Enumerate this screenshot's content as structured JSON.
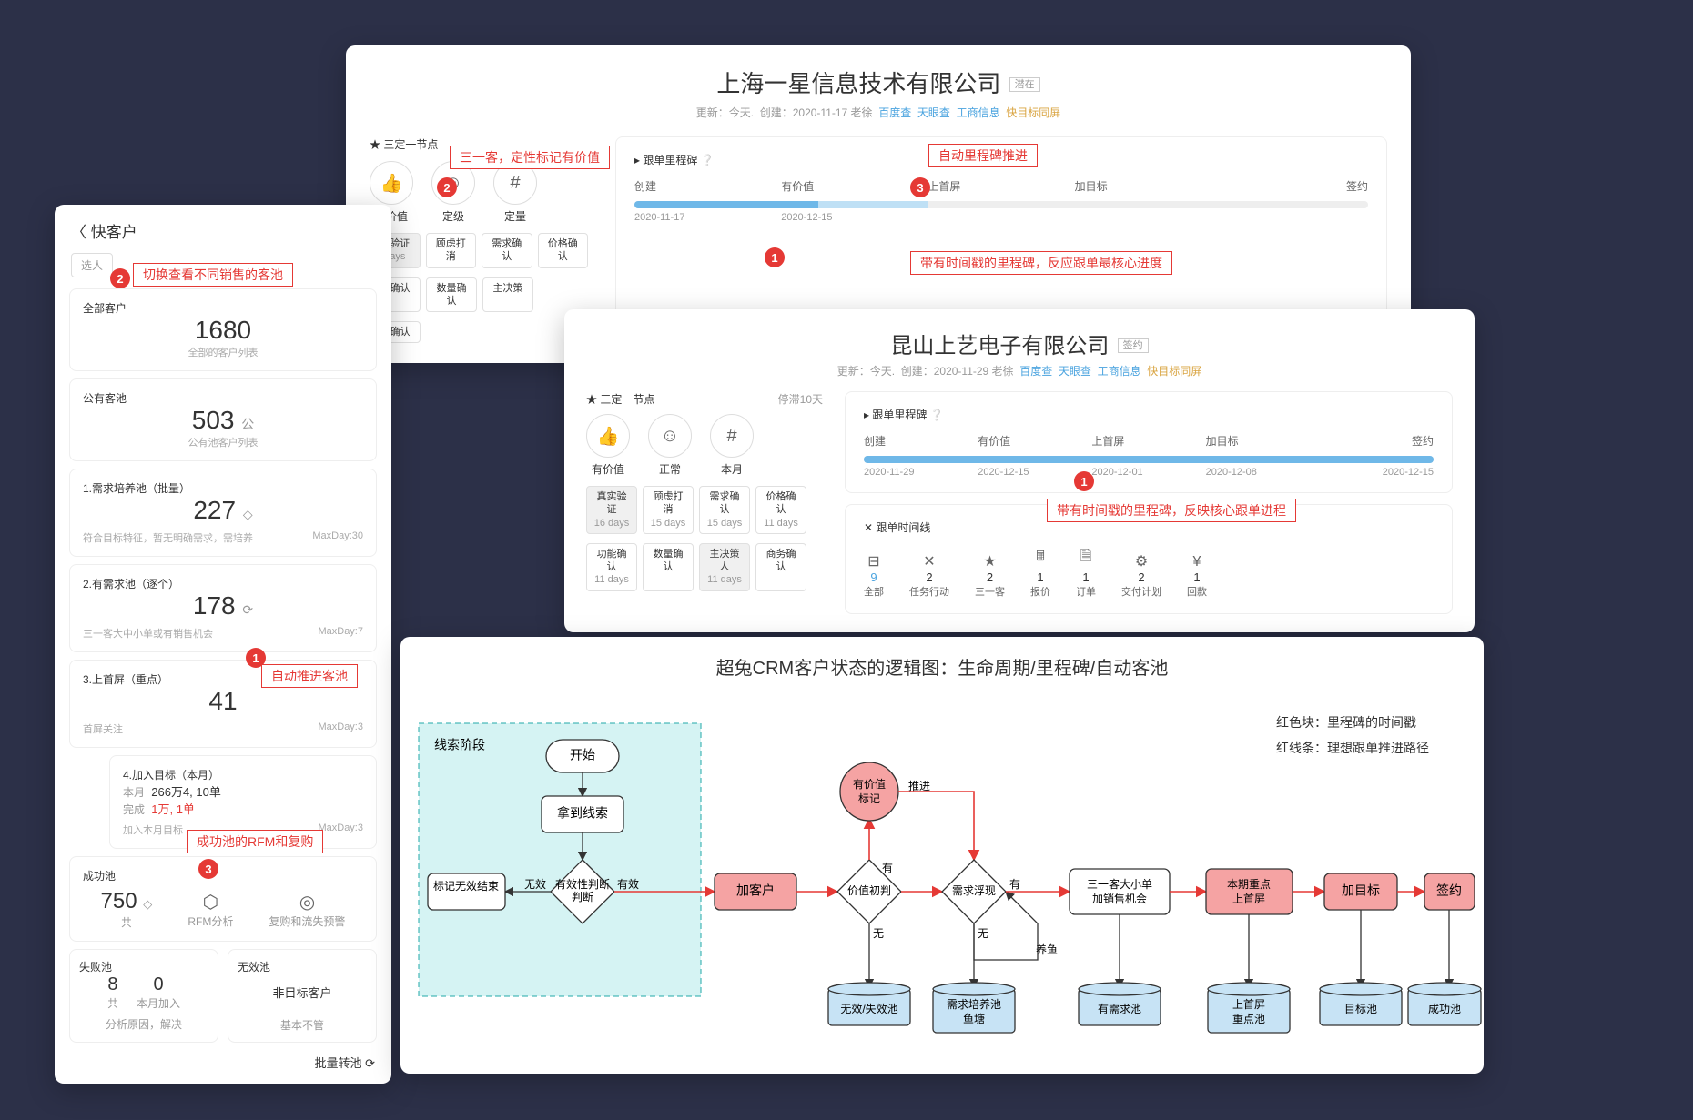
{
  "annotations": {
    "a1_label": "三一客，定性标记有价值",
    "a2_label": "自动里程碑推进",
    "a3_label": "带有时间戳的里程碑，反应跟单最核心进度",
    "b3_label": "带有时间戳的里程碑，反映核心跟单进程",
    "l2_label": "切换查看不同销售的客池",
    "l1_label": "自动推进客池",
    "l3_label": "成功池的RFM和复购"
  },
  "top": {
    "company": "上海一星信息技术有限公司",
    "badge": "潜在",
    "update_prefix": "更新：",
    "update_val": "今天.",
    "create_prefix": "创建：",
    "create_val": "2020-11-17 老徐",
    "links": [
      "百度查",
      "天眼查",
      "工商信息",
      "快目标同屏"
    ],
    "section_star": "★ 三定一节点",
    "chips": [
      {
        "icon": "👍",
        "label": "有价值"
      },
      {
        "icon": "☺",
        "label": "定级"
      },
      {
        "icon": "#",
        "label": "定量"
      }
    ],
    "tags_top": [
      {
        "t": "实验证",
        "s": "days",
        "on": true
      },
      {
        "t": "顾虑打消",
        "s": "",
        "on": false
      },
      {
        "t": "需求确认",
        "s": "",
        "on": false
      },
      {
        "t": "价格确认",
        "s": "",
        "on": false
      }
    ],
    "tags_mid": [
      {
        "t": "能确认",
        "s": "",
        "on": false
      },
      {
        "t": "数量确认",
        "s": "",
        "on": false
      },
      {
        "t": "主决策",
        "s": "",
        "on": false
      }
    ],
    "tags_bot": [
      {
        "t": "实确认",
        "s": "",
        "on": false
      }
    ],
    "ms_title": "▸ 跟单里程碑 ❔",
    "ms_labels": [
      "创建",
      "有价值",
      "上首屏",
      "加目标",
      "签约"
    ],
    "ms_dates": [
      "2020-11-17",
      "2020-12-15",
      "",
      "",
      ""
    ],
    "ms_fill_2": 20
  },
  "mid": {
    "company": "昆山上艺电子有限公司",
    "badge": "签约",
    "update_prefix": "更新：",
    "update_val": "今天.",
    "create_prefix": "创建：",
    "create_val": "2020-11-29 老徐",
    "links": [
      "百度查",
      "天眼查",
      "工商信息",
      "快目标同屏"
    ],
    "section_star": "★ 三定一节点",
    "stale": "停滞10天",
    "chips": [
      {
        "icon": "👍",
        "label": "有价值"
      },
      {
        "icon": "☺",
        "label": "正常"
      },
      {
        "icon": "#",
        "label": "本月"
      }
    ],
    "tags_top": [
      {
        "t": "真实验证",
        "s": "16 days",
        "on": true
      },
      {
        "t": "顾虑打消",
        "s": "15 days",
        "on": false
      },
      {
        "t": "需求确认",
        "s": "15 days",
        "on": false
      },
      {
        "t": "价格确认",
        "s": "11 days",
        "on": false
      }
    ],
    "tags_bot": [
      {
        "t": "功能确认",
        "s": "11 days",
        "on": false
      },
      {
        "t": "数量确认",
        "s": "",
        "on": false
      },
      {
        "t": "主决策人",
        "s": "11 days",
        "on": true
      },
      {
        "t": "商务确认",
        "s": "",
        "on": false
      }
    ],
    "ms_title": "▸ 跟单里程碑 ❔",
    "ms_labels": [
      "创建",
      "有价值",
      "上首屏",
      "加目标",
      "签约"
    ],
    "ms_dates": [
      "2020-11-29",
      "2020-12-15",
      "2020-12-01",
      "2020-12-08",
      "2020-12-15"
    ],
    "tl_title": "✕ 跟单时间线",
    "stats": [
      {
        "ico": "⊟",
        "v": "9",
        "lb": "全部"
      },
      {
        "ico": "✕",
        "v": "2",
        "lb": "任务行动"
      },
      {
        "ico": "★",
        "v": "2",
        "lb": "三一客"
      },
      {
        "ico": "🖩",
        "v": "1",
        "lb": "报价"
      },
      {
        "ico": "🗎",
        "v": "1",
        "lb": "订单"
      },
      {
        "ico": "⚙",
        "v": "2",
        "lb": "交付计划"
      },
      {
        "ico": "¥",
        "v": "1",
        "lb": "回款"
      }
    ]
  },
  "left": {
    "title": "〈 快客户",
    "selector": "选人",
    "card_all_t": "全部客户",
    "card_all_v": "1680",
    "card_all_m": "全部的客户列表",
    "card_pub_t": "公有客池",
    "card_pub_v": "503",
    "card_pub_u": "公",
    "card_pub_m": "公有池客户列表",
    "p1_t": "1.需求培养池（批量）",
    "p1_v": "227",
    "p1_u": "◇",
    "p1_m1": "符合目标特征，暂无明确需求，需培养",
    "p1_m2": "MaxDay:30",
    "p2_t": "2.有需求池（逐个）",
    "p2_v": "178",
    "p2_u": "⟳",
    "p2_m1": "三一客大中小单或有销售机会",
    "p2_m2": "MaxDay:7",
    "p3_t": "3.上首屏（重点）",
    "p3_v": "41",
    "p3_m1": "首屏关注",
    "p3_m2": "MaxDay:3",
    "p4_t": "4.加入目标（本月）",
    "p4_l1a": "本月",
    "p4_l1b": "266万4, 10单",
    "p4_l2a": "完成",
    "p4_l2b": "1万, 1单",
    "p4_m1": "加入本月目标",
    "p4_m2": "MaxDay:3",
    "succ_t": "成功池",
    "succ_v": "750",
    "succ_u": "◇",
    "succ_sub": "共",
    "rfm_lb": "RFM分析",
    "churn_lb": "复购和流失预警",
    "fail_t": "失败池",
    "fail_v1": "8",
    "fail_l1": "共",
    "fail_v2": "0",
    "fail_l2": "本月加入",
    "fail_m": "分析原因，解决",
    "inv_t": "无效池",
    "inv_m": "非目标客户",
    "inv_m2": "基本不管",
    "btn": "批量转池 ⟳"
  },
  "flow": {
    "title": "超兔CRM客户状态的逻辑图：生命周期/里程碑/自动客池",
    "legend1": "红色块：里程碑的时间戳",
    "legend2": "红线条：理想跟单推进路径",
    "stage_label": "线索阶段",
    "n_start": "开始",
    "n_getlead": "拿到线索",
    "n_valid": "有效性判断",
    "n_valid_y": "有效",
    "n_valid_n": "无效",
    "n_invalid_end": "标记无效结束",
    "n_addcust": "加客户",
    "n_valuemark_1": "有价值",
    "n_valuemark_2": "标记",
    "n_push": "推进",
    "n_valjudge": "价值初判",
    "n_yes": "有",
    "n_no": "无",
    "n_need": "需求浮现",
    "n_nurture": "养鱼",
    "n_opp_1": "三一客大小单",
    "n_opp_2": "加销售机会",
    "n_focus_1": "本期重点",
    "n_focus_2": "上首屏",
    "n_target": "加目标",
    "n_sign": "签约",
    "p_invalid": "无效/失效池",
    "p_nurture_1": "需求培养池",
    "p_nurture_2": "鱼塘",
    "p_need": "有需求池",
    "p_focus_1": "上首屏",
    "p_focus_2": "重点池",
    "p_target": "目标池",
    "p_succ": "成功池"
  }
}
